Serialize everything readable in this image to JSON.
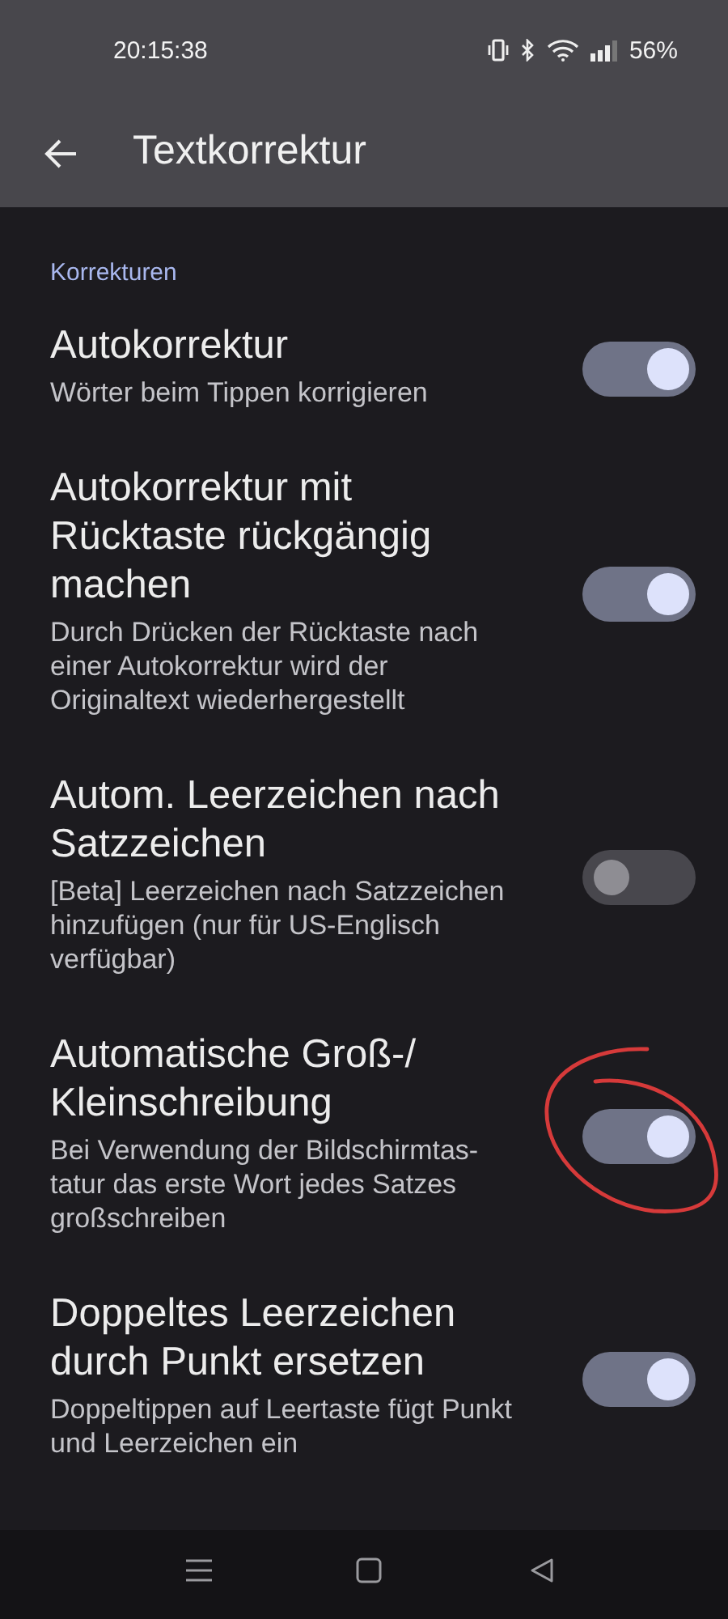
{
  "status_bar": {
    "time": "20:15:38",
    "battery": "56%"
  },
  "app_bar": {
    "title": "Textkorrektur"
  },
  "section": {
    "title": "Korrekturen"
  },
  "settings": [
    {
      "title": "Autokorrektur",
      "summary": "Wörter beim Tippen korrigieren",
      "on": true,
      "circled": false
    },
    {
      "title": "Autokorrektur mit Rücktaste rückgängig machen",
      "summary": "Durch Drücken der Rücktaste nach einer Autokorrektur wird der Originaltext wiederhergestellt",
      "on": true,
      "circled": false
    },
    {
      "title": "Autom. Leerzeichen nach Satzzeichen",
      "summary": "[Beta] Leerzeichen nach Satzzeichen hinzufügen (nur für US-Englisch verfügbar)",
      "on": false,
      "circled": false
    },
    {
      "title": "Automatische Groß-/ Kleinschreibung",
      "summary": "Bei Verwendung der Bildschirmtas-tatur das erste Wort jedes Satzes großschreiben",
      "on": true,
      "circled": true
    },
    {
      "title": "Doppeltes Leerzeichen durch Punkt ersetzen",
      "summary": "Doppeltippen auf Leertaste fügt Punkt und Leerzeichen ein",
      "on": true,
      "circled": false
    }
  ]
}
